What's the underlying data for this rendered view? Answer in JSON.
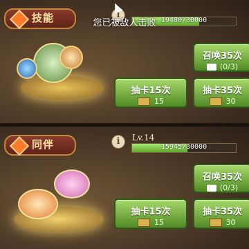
{
  "toast": "您已被敌人击败",
  "skill": {
    "title": "技能",
    "level_label": "",
    "exp": "19480/30000",
    "exp_fraction": 0.649,
    "summon_label": "召唤35次",
    "summon_count": "(0/3)",
    "draw15_label": "抽卡15次",
    "draw15_cost": "15",
    "draw35_label": "抽卡35次",
    "draw35_cost": "30"
  },
  "partner": {
    "title": "同伴",
    "level_label": "Lv.14",
    "exp": "15945/30000",
    "exp_fraction": 0.531,
    "summon_label": "召唤35次",
    "summon_count": "(0/3)",
    "draw15_label": "抽卡15次",
    "draw15_cost": "15",
    "draw35_label": "抽卡35次",
    "draw35_cost": "30"
  },
  "icons": {
    "info": "i",
    "colors": {
      "green_button": "#6fb53a",
      "orange_icon": "#ff7b2c",
      "title_text": "#ffe4a6"
    }
  }
}
